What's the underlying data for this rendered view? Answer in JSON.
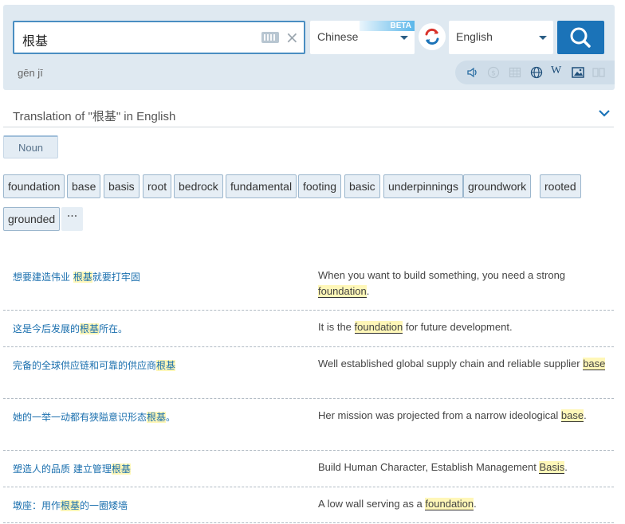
{
  "search": {
    "query": "根基",
    "pinyin": "gēn jī",
    "source_lang": "Chinese",
    "target_lang": "English",
    "beta_label": "BETA",
    "clear_glyph": "×"
  },
  "toolbar": {
    "icons": [
      "speaker-icon",
      "currency-icon",
      "grid-icon",
      "globe-icon",
      "wikipedia-icon",
      "image-icon",
      "book-icon"
    ],
    "wiki_glyph": "W"
  },
  "translation": {
    "header": "Translation of \"根基\" in English",
    "pos_tab": "Noun",
    "chips": [
      "foundation",
      "base",
      "basis",
      "root",
      "bedrock",
      "fundamental",
      "footing",
      "basic",
      "underpinnings",
      "groundwork",
      "rooted",
      "grounded"
    ],
    "more_glyph": "···"
  },
  "examples": [
    {
      "src_pre": "想要建造伟业 ",
      "src_hl": "根基",
      "src_post": "就要打牢固",
      "tgt_pre": "When you want to build something, you need a strong ",
      "tgt_hl": "foundation",
      "tgt_post": "."
    },
    {
      "src_pre": "这是今后发展的",
      "src_hl": "根基",
      "src_post": "所在。",
      "tgt_pre": "It is the ",
      "tgt_hl": "foundation",
      "tgt_post": " for future development."
    },
    {
      "src_pre": "完备的全球供应链和可靠的供应商",
      "src_hl": "根基",
      "src_post": "",
      "tgt_pre": "Well established global supply chain and reliable supplier ",
      "tgt_hl": "base",
      "tgt_post": ""
    },
    {
      "src_pre": "她的一举一动都有狭隘意识形态",
      "src_hl": "根基",
      "src_post": "。",
      "tgt_pre": "Her mission was projected from a narrow ideological ",
      "tgt_hl": "base",
      "tgt_post": "."
    },
    {
      "src_pre": "塑造人的品质 建立管理",
      "src_hl": "根基",
      "src_post": "",
      "tgt_pre": "Build Human Character, Establish Management ",
      "tgt_hl": "Basis",
      "tgt_post": "."
    },
    {
      "src_pre": "墩座：用作",
      "src_hl": "根基",
      "src_post": "的一圈矮墙",
      "tgt_pre": "A low wall serving as a ",
      "tgt_hl": "foundation",
      "tgt_post": "."
    }
  ],
  "colors": {
    "accent": "#1b73b8",
    "panel": "#dfe9f1",
    "highlight": "#fff7b8",
    "link": "#1a6fae"
  }
}
